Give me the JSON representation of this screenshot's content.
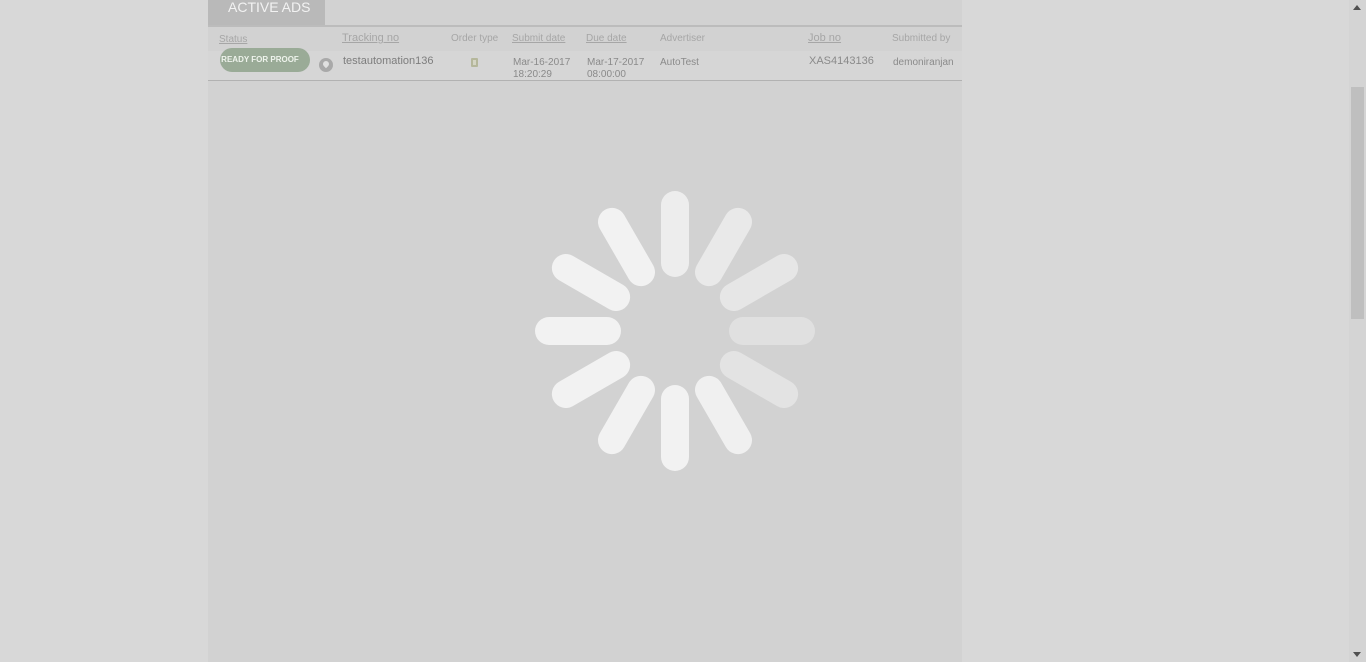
{
  "tab": {
    "label": "ACTIVE ADS"
  },
  "table": {
    "headers": {
      "status": "Status",
      "tracking_no": "Tracking no",
      "order_type": "Order type",
      "submit_date": "Submit date",
      "due_date": "Due date",
      "advertiser": "Advertiser",
      "job_no": "Job no",
      "submitted_by": "Submitted by"
    },
    "rows": [
      {
        "status": "READY FOR PROOF",
        "tracking_no": "testautomation136",
        "submit_date_line1": "Mar-16-2017",
        "submit_date_line2": "18:20:29",
        "due_date_line1": "Mar-17-2017",
        "due_date_line2": "08:00:00",
        "advertiser": "AutoTest",
        "job_no": "XAS4143136",
        "submitted_by": "demoniranjan"
      }
    ]
  },
  "icons": {
    "info": "info-pin-icon",
    "order_type": "document-icon",
    "loading": "loading-spinner-icon",
    "scroll_up": "arrow-up-icon",
    "scroll_down": "arrow-down-icon"
  },
  "colors": {
    "status_pill": "#9aab97",
    "overlay": "#d8d8d8",
    "spinner": "#f2f2f2"
  }
}
